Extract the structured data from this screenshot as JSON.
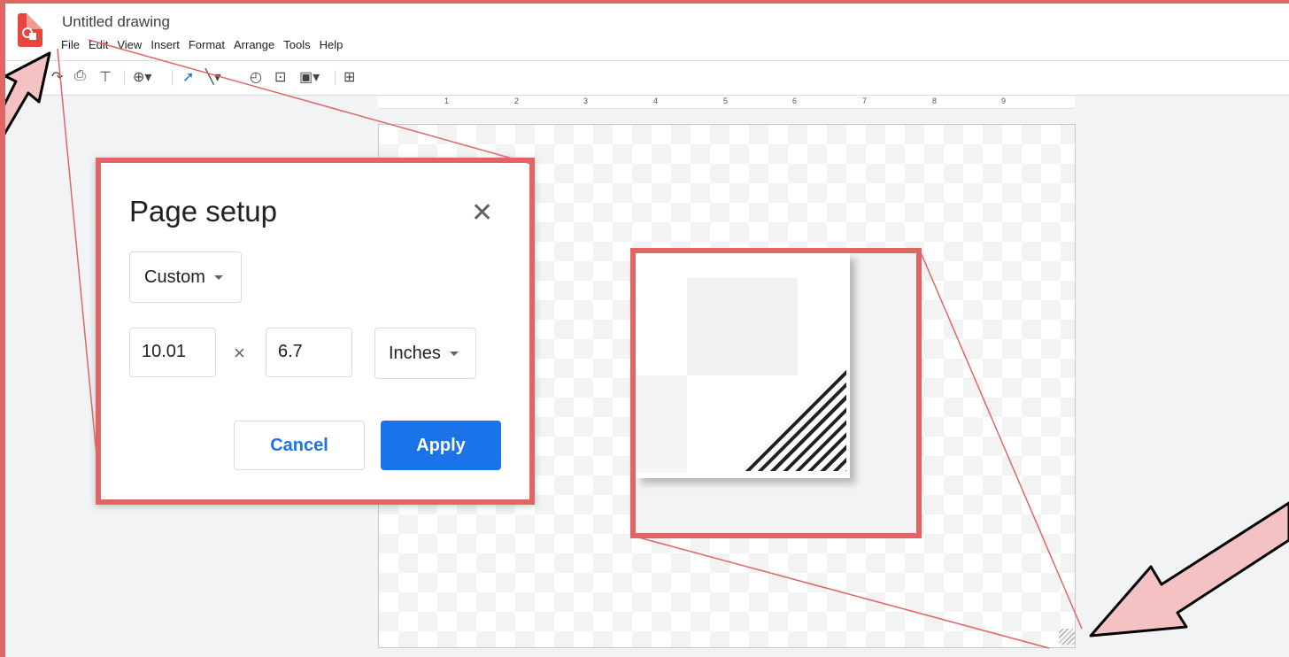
{
  "app": {
    "title": "Untitled drawing"
  },
  "menu": [
    "File",
    "Edit",
    "View",
    "Insert",
    "Format",
    "Arrange",
    "Tools",
    "Help"
  ],
  "toolbar": {
    "icons": [
      "redo-icon",
      "print-icon",
      "paint-format-icon",
      "zoom-icon",
      "select-icon",
      "line-icon",
      "shape-icon",
      "text-box-icon",
      "image-icon",
      "add-comment-icon"
    ]
  },
  "ruler": {
    "numbers": [
      "1",
      "2",
      "3",
      "4",
      "5",
      "6",
      "7",
      "8",
      "9"
    ]
  },
  "dialog": {
    "title": "Page setup",
    "preset": "Custom",
    "width": "10.01",
    "times": "×",
    "height": "6.7",
    "units": "Inches",
    "cancel": "Cancel",
    "apply": "Apply"
  },
  "colors": {
    "accent": "#1a73e8",
    "highlight": "#e06666",
    "arrow": "#f4c2c2"
  }
}
